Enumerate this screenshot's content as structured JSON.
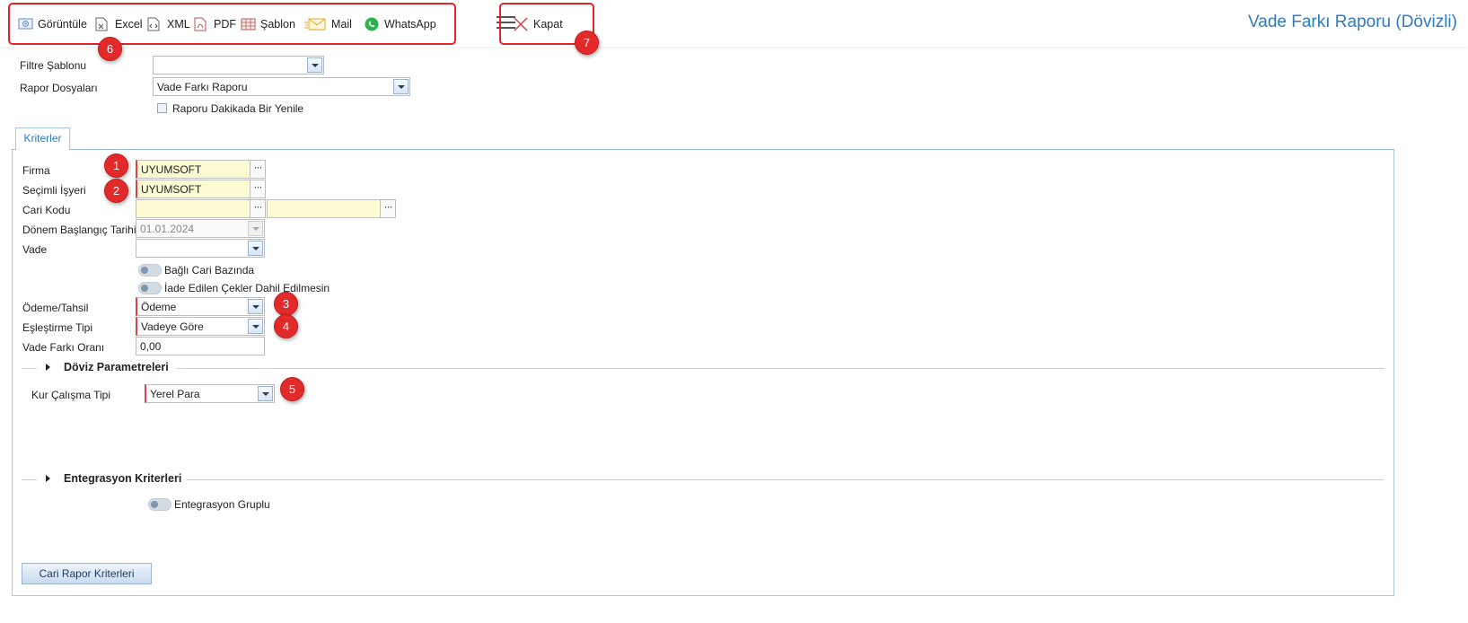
{
  "toolbar": {
    "items": [
      {
        "label": "Görüntüle",
        "icon": "preview-icon"
      },
      {
        "label": "Excel",
        "icon": "excel-icon"
      },
      {
        "label": "XML",
        "icon": "xml-icon"
      },
      {
        "label": "PDF",
        "icon": "pdf-icon"
      },
      {
        "label": "Şablon",
        "icon": "template-icon"
      },
      {
        "label": "Mail",
        "icon": "mail-icon"
      },
      {
        "label": "WhatsApp",
        "icon": "whatsapp-icon"
      }
    ],
    "close_label": "Kapat",
    "badge_tools": "6",
    "badge_close": "7"
  },
  "page_title": "Vade Farkı Raporu (Dövizli)",
  "top_form": {
    "filter_template_label": "Filtre Şablonu",
    "filter_template_value": "",
    "report_files_label": "Rapor Dosyaları",
    "report_files_value": "Vade Farkı Raporu",
    "refresh_label": "Raporu Dakikada Bir Yenile"
  },
  "tab_label": "Kriterler",
  "criteria": {
    "firma_label": "Firma",
    "firma_value": "UYUMSOFT",
    "isyeri_label": "Seçimli İşyeri",
    "isyeri_value": "UYUMSOFT",
    "cari_label": "Cari Kodu",
    "cari_from": "",
    "cari_to": "",
    "donem_label": "Dönem Başlangıç Tarihi",
    "donem_value": "01.01.2024",
    "vade_label": "Vade",
    "vade_value": "",
    "bagli_cari_label": "Bağlı Cari Bazında",
    "iade_label": "İade Edilen Çekler Dahil Edilmesin",
    "odeme_label": "Ödeme/Tahsil",
    "odeme_value": "Ödeme",
    "eslestirme_label": "Eşleştirme Tipi",
    "eslestirme_value": "Vadeye Göre",
    "oran_label": "Vade Farkı Oranı",
    "oran_value": "0,00"
  },
  "doviz": {
    "section_title": "Döviz Parametreleri",
    "kur_label": "Kur Çalışma Tipi",
    "kur_value": "Yerel Para"
  },
  "entegrasyon": {
    "section_title": "Entegrasyon Kriterleri",
    "gruplu_label": "Entegrasyon Gruplu"
  },
  "cari_button_label": "Cari Rapor Kriterleri",
  "badges": {
    "firma": "1",
    "isyeri": "2",
    "odeme": "3",
    "eslestirme": "4",
    "kur": "5"
  },
  "colors": {
    "accent": "#2e7bc0",
    "annotation_red": "#e32a2a",
    "required_yellow": "#fdfbd2"
  }
}
